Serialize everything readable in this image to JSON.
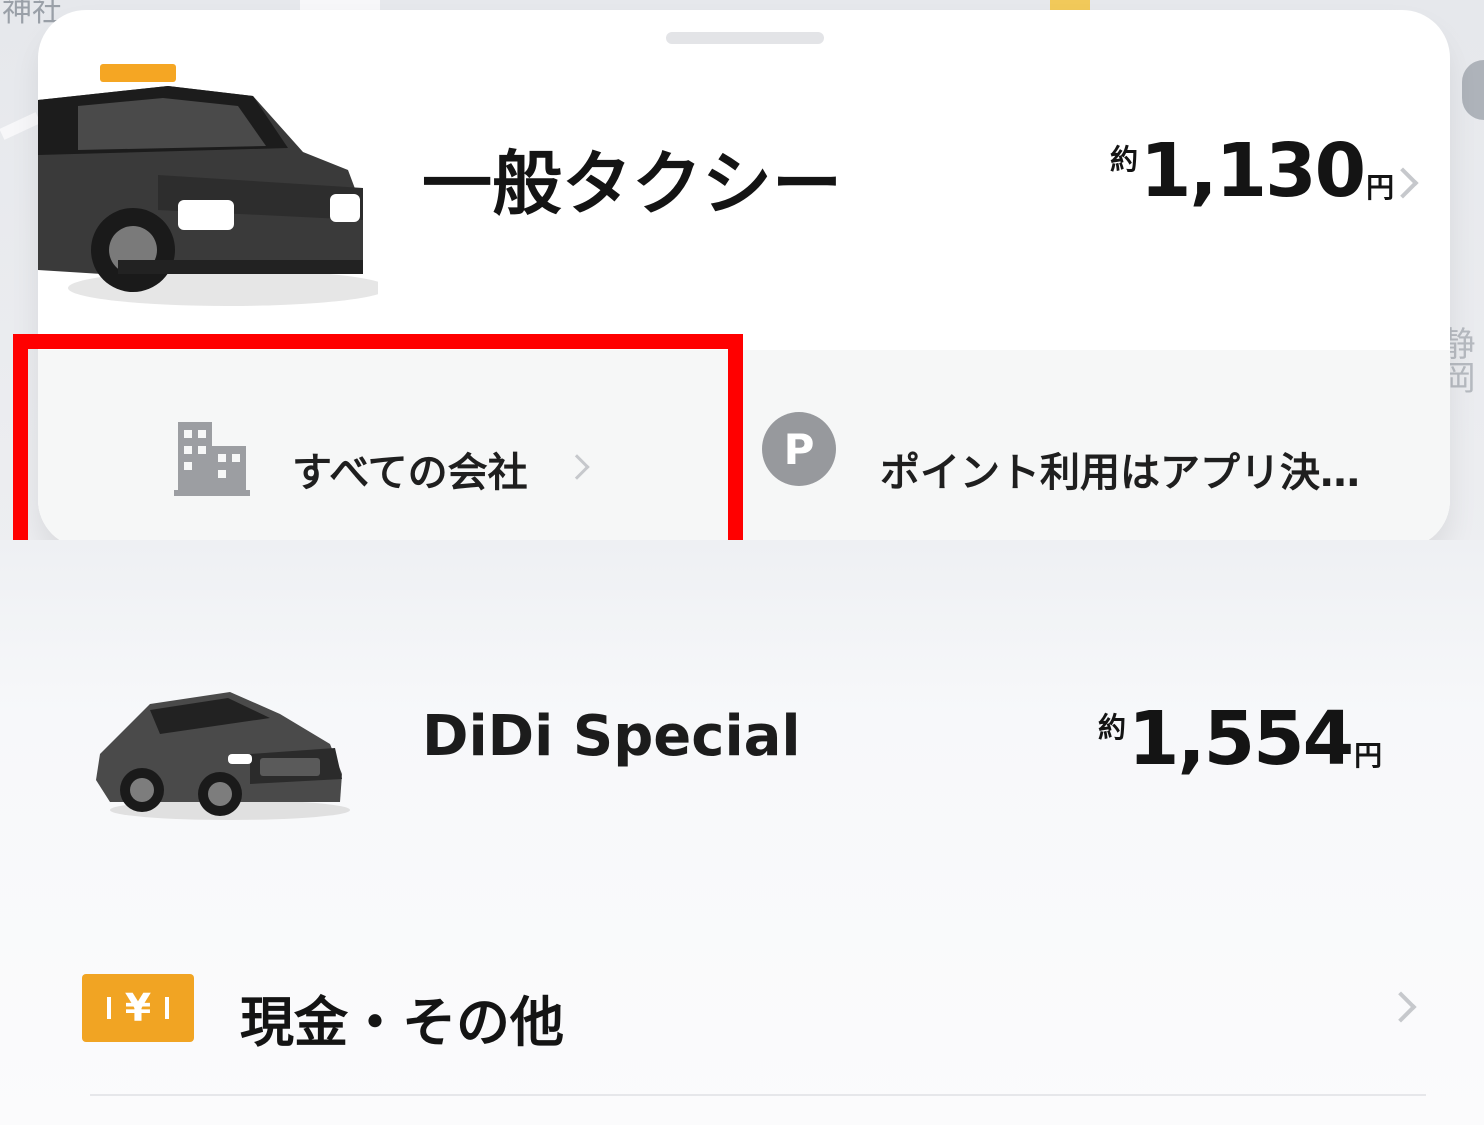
{
  "map": {
    "label_left": "神社",
    "label_right": "静岡"
  },
  "selected_vehicle": {
    "name": "一般タクシー",
    "price_prefix": "約",
    "price_value": "1,130",
    "price_unit": "円",
    "image_icon": "taxi-car-image"
  },
  "company_option": {
    "label": "すべての会社",
    "icon": "building-icon"
  },
  "points_option": {
    "badge": "P",
    "label": "ポイント利用はアプリ決…"
  },
  "other_vehicle": {
    "name": "DiDi Special",
    "price_prefix": "約",
    "price_value": "1,554",
    "price_unit": "円",
    "image_icon": "sedan-car-image"
  },
  "payment": {
    "label": "現金・その他",
    "icon": "yen-cash-icon",
    "badge_symbol": "¥",
    "accent_color": "#f1a423"
  },
  "highlight_color": "#ff0000"
}
